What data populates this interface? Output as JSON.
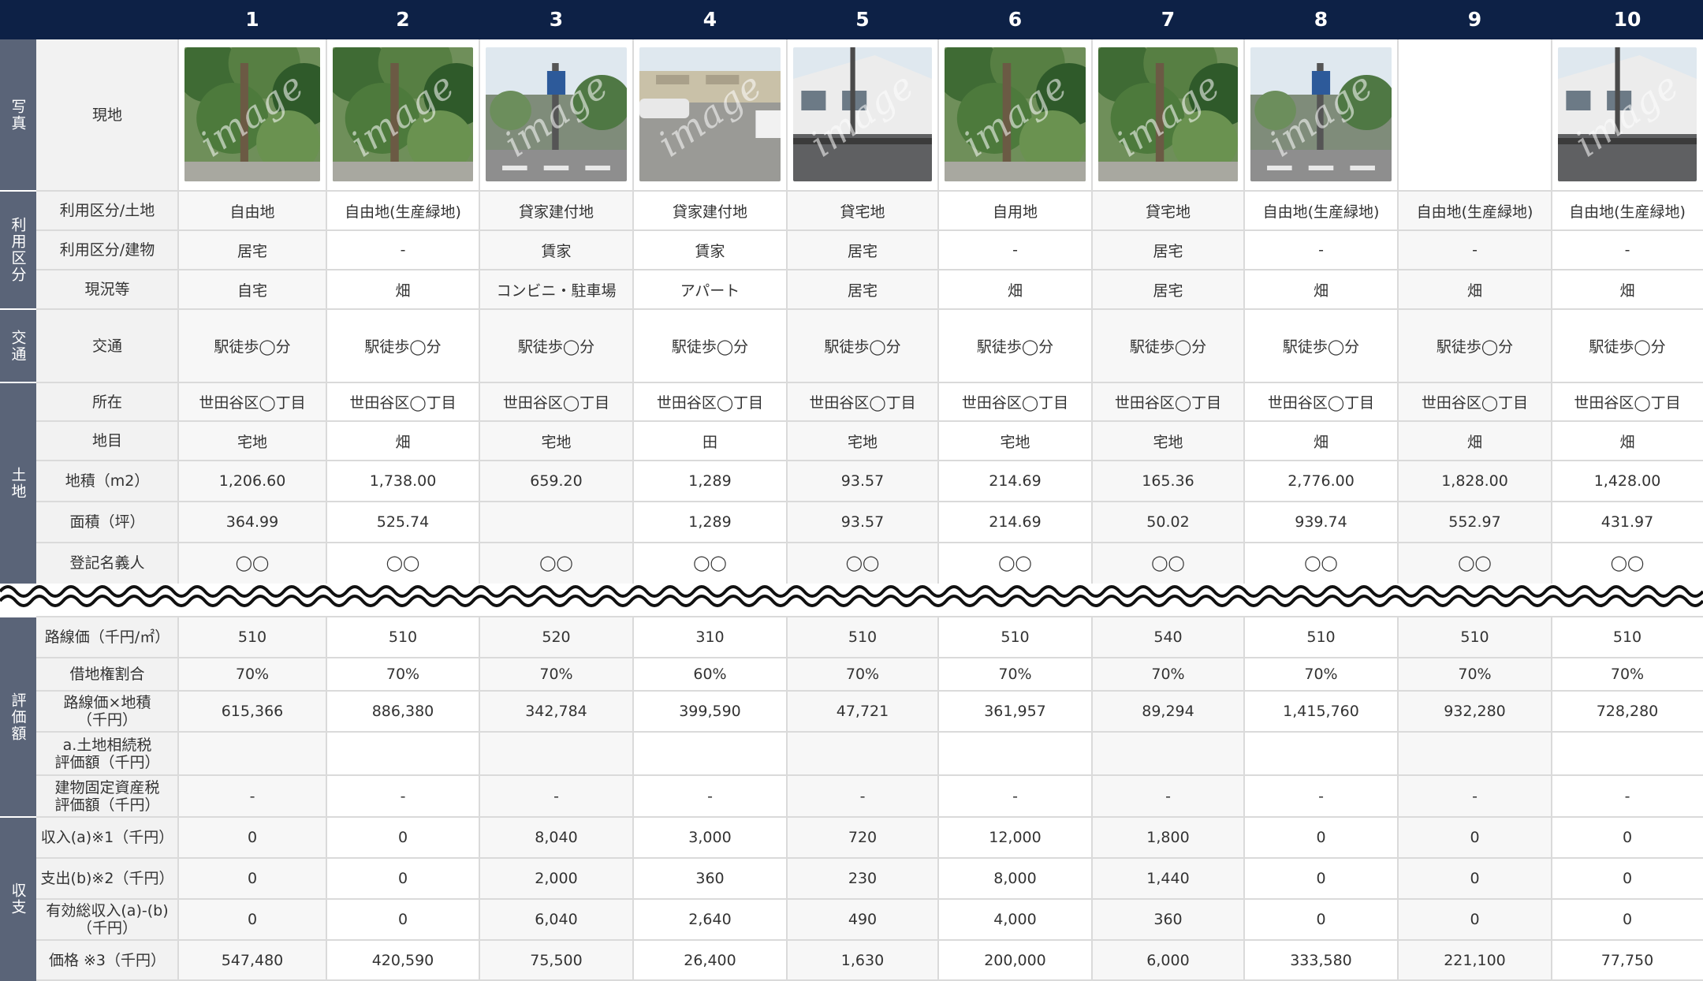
{
  "columns": [
    "1",
    "2",
    "3",
    "4",
    "5",
    "6",
    "7",
    "8",
    "9",
    "10"
  ],
  "groups": [
    {
      "label": "写真"
    },
    {
      "label": "利用区分"
    },
    {
      "label": "交通"
    },
    {
      "label": "土地"
    },
    {
      "label": "評価額"
    },
    {
      "label": "収支"
    }
  ],
  "rows": [
    {
      "label": "現地",
      "values": [
        "",
        "",
        "",
        "",
        "",
        "",
        "",
        "",
        "",
        ""
      ]
    },
    {
      "label": "利用区分/土地",
      "values": [
        "自由地",
        "自由地(生産緑地)",
        "貸家建付地",
        "貸家建付地",
        "貸宅地",
        "自用地",
        "貸宅地",
        "自由地(生産緑地)",
        "自由地(生産緑地)",
        "自由地(生産緑地)"
      ]
    },
    {
      "label": "利用区分/建物",
      "values": [
        "居宅",
        "-",
        "賃家",
        "賃家",
        "居宅",
        "-",
        "居宅",
        "-",
        "-",
        "-"
      ]
    },
    {
      "label": "現況等",
      "values": [
        "自宅",
        "畑",
        "コンビニ・駐車場",
        "アパート",
        "居宅",
        "畑",
        "居宅",
        "畑",
        "畑",
        "畑"
      ]
    },
    {
      "label": "交通",
      "values": [
        "駅徒歩◯分",
        "駅徒歩◯分",
        "駅徒歩◯分",
        "駅徒歩◯分",
        "駅徒歩◯分",
        "駅徒歩◯分",
        "駅徒歩◯分",
        "駅徒歩◯分",
        "駅徒歩◯分",
        "駅徒歩◯分"
      ]
    },
    {
      "label": "所在",
      "values": [
        "世田谷区◯丁目",
        "世田谷区◯丁目",
        "世田谷区◯丁目",
        "世田谷区◯丁目",
        "世田谷区◯丁目",
        "世田谷区◯丁目",
        "世田谷区◯丁目",
        "世田谷区◯丁目",
        "世田谷区◯丁目",
        "世田谷区◯丁目"
      ]
    },
    {
      "label": "地目",
      "values": [
        "宅地",
        "畑",
        "宅地",
        "田",
        "宅地",
        "宅地",
        "宅地",
        "畑",
        "畑",
        "畑"
      ]
    },
    {
      "label": "地積（m2）",
      "values": [
        "1,206.60",
        "1,738.00",
        "659.20",
        "1,289",
        "93.57",
        "214.69",
        "165.36",
        "2,776.00",
        "1,828.00",
        "1,428.00"
      ]
    },
    {
      "label": "面積（坪）",
      "values": [
        "364.99",
        "525.74",
        "",
        "1,289",
        "93.57",
        "214.69",
        "50.02",
        "939.74",
        "552.97",
        "431.97"
      ]
    },
    {
      "label": "登記名義人",
      "values": [
        "◯◯",
        "◯◯",
        "◯◯",
        "◯◯",
        "◯◯",
        "◯◯",
        "◯◯",
        "◯◯",
        "◯◯",
        "◯◯"
      ]
    },
    {
      "label": "路線価（千円/㎡）",
      "values": [
        "510",
        "510",
        "520",
        "310",
        "510",
        "510",
        "540",
        "510",
        "510",
        "510"
      ]
    },
    {
      "label": "借地権割合",
      "values": [
        "70%",
        "70%",
        "70%",
        "60%",
        "70%",
        "70%",
        "70%",
        "70%",
        "70%",
        "70%"
      ]
    },
    {
      "label": "路線価×地積\n（千円）",
      "values": [
        "615,366",
        "886,380",
        "342,784",
        "399,590",
        "47,721",
        "361,957",
        "89,294",
        "1,415,760",
        "932,280",
        "728,280"
      ]
    },
    {
      "label": "a.土地相続税\n評価額（千円）",
      "values": [
        "",
        "",
        "",
        "",
        "",
        "",
        "",
        "",
        "",
        ""
      ]
    },
    {
      "label": "建物固定資産税\n評価額（千円）",
      "values": [
        "-",
        "-",
        "-",
        "-",
        "-",
        "-",
        "-",
        "-",
        "-",
        "-"
      ]
    },
    {
      "label": "収入(a)※1（千円）",
      "values": [
        "0",
        "0",
        "8,040",
        "3,000",
        "720",
        "12,000",
        "1,800",
        "0",
        "0",
        "0"
      ]
    },
    {
      "label": "支出(b)※2（千円）",
      "values": [
        "0",
        "0",
        "2,000",
        "360",
        "230",
        "8,000",
        "1,440",
        "0",
        "0",
        "0"
      ]
    },
    {
      "label": "有効総収入(a)-(b)\n（千円）",
      "values": [
        "0",
        "0",
        "6,040",
        "2,640",
        "490",
        "4,000",
        "360",
        "0",
        "0",
        "0"
      ]
    },
    {
      "label": "価格 ※3（千円）",
      "values": [
        "547,480",
        "420,590",
        "75,500",
        "26,400",
        "1,630",
        "200,000",
        "6,000",
        "333,580",
        "221,100",
        "77,750"
      ]
    }
  ],
  "photos": [
    {
      "kind": "trees",
      "watermark": "image"
    },
    {
      "kind": "trees",
      "watermark": "image"
    },
    {
      "kind": "street",
      "watermark": "image"
    },
    {
      "kind": "parking",
      "watermark": "image"
    },
    {
      "kind": "house",
      "watermark": "image"
    },
    {
      "kind": "trees",
      "watermark": "image"
    },
    {
      "kind": "trees",
      "watermark": "image"
    },
    {
      "kind": "street",
      "watermark": "image"
    },
    {
      "kind": "none",
      "watermark": ""
    },
    {
      "kind": "house",
      "watermark": "image"
    }
  ],
  "colors": {
    "header_bg": "#0d2146",
    "group_bg": "#5a6478",
    "label_bg": "#f2f2f2",
    "stripe_bg": "#f7f7f7",
    "grid": "#dadada"
  }
}
